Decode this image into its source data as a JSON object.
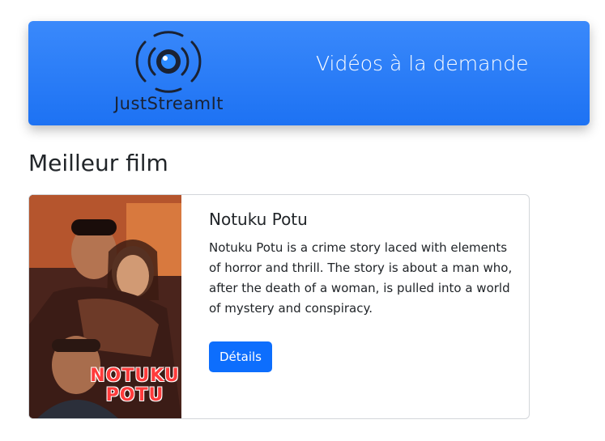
{
  "header": {
    "logo_text": "JustStreamIt",
    "tagline": "Vidéos à la demande",
    "logo_icon": "camera-lens-icon"
  },
  "best_movie": {
    "section_title": "Meilleur film",
    "title": "Notuku Potu",
    "description": "Notuku Potu is a crime story laced with elements of horror and thrill. The story is about a man who, after the death of a woman, is pulled into a world of mystery and conspiracy.",
    "details_button": "Détails",
    "poster_title": "NOTUKU POTU"
  },
  "colors": {
    "header_blue": "#1d72f3",
    "button_blue": "#0d6efd",
    "poster_title_red": "#ff3b3b"
  }
}
